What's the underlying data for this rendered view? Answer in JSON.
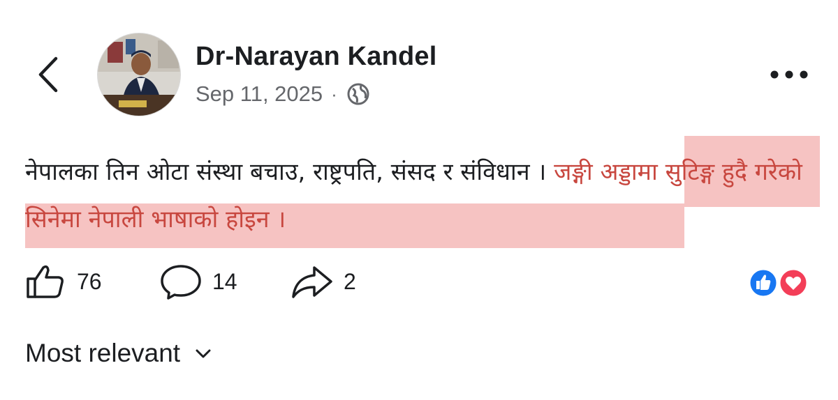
{
  "header": {
    "author_name": "Dr-Narayan Kandel",
    "date": "Sep 11, 2025",
    "separator": "·",
    "audience_icon": "globe-icon"
  },
  "post": {
    "text_plain": "नेपालका तिन ओटा संस्था बचाउ, राष्ट्रपति, संसद र संविधान । ",
    "text_highlighted": "जङ्गी अड्डामा सुटिङ्ग हुदै गरेको सिनेमा नेपाली भाषाको होइन ।",
    "highlight_color": "#f6c3c2",
    "highlight_text_color": "#c8473f"
  },
  "actions": {
    "like_count": "76",
    "comment_count": "14",
    "share_count": "2"
  },
  "reactions": {
    "icons": [
      "like-reaction-icon",
      "love-reaction-icon"
    ],
    "like_color": "#1877f2",
    "love_color": "#f33e58"
  },
  "comments": {
    "sort_label": "Most relevant"
  }
}
